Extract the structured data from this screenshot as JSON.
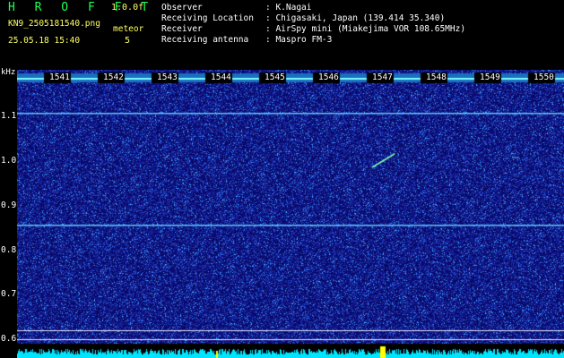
{
  "header": {
    "app_title": "H R O F F T",
    "version": "1.0.0f",
    "filename": "KN9_2505181540.png",
    "datetime": "25.05.18 15:40",
    "meteor_label": "meteor",
    "meteor_count": "5"
  },
  "station": {
    "observer_key": "Observer",
    "observer_val": ": K.Nagai",
    "location_key": "Receiving Location",
    "location_val": ": Chigasaki, Japan (139.414 35.340)",
    "receiver_key": "Receiver",
    "receiver_val": ": AirSpy mini (Miakejima VOR 108.65MHz)",
    "antenna_key": "Receiving antenna",
    "antenna_val": ": Maspro FM-3"
  },
  "axis": {
    "unit": "kHz",
    "ticks": [
      "1.1",
      "1.0",
      "0.9",
      "0.8",
      "0.7",
      "0.6"
    ],
    "minute_marks": [
      "1541",
      "1542",
      "1543",
      "1544",
      "1545",
      "1546",
      "1547",
      "1548",
      "1549",
      "1550"
    ]
  },
  "colors": {
    "background": "#0a0a6a",
    "noise_bright": "#3aa0ff",
    "signal": "#7dfcff",
    "tone_line": "#5cc8ff",
    "bottom_trace": "#00e5ff",
    "marker_yellow": "#ffff00"
  }
}
